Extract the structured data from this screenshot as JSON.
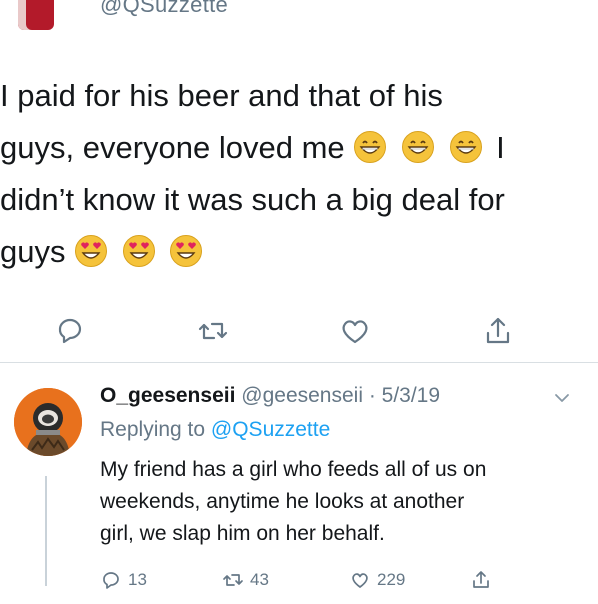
{
  "original_tweet": {
    "handle": "@QSuzzette",
    "text_lines": [
      "I paid for his beer and that of his",
      "guys, everyone loved me",
      "I",
      "didn’t know it was such a big deal for",
      "guys"
    ],
    "emojis": {
      "line2": [
        "grinning-face",
        "grinning-face",
        "grinning-face"
      ],
      "line4": [
        "heart-eyes-face",
        "heart-eyes-face",
        "heart-eyes-face"
      ]
    },
    "actions": [
      "reply-icon",
      "retweet-icon",
      "like-icon",
      "share-icon"
    ]
  },
  "reply": {
    "name": "O_geesenseii",
    "meta": "@geesenseii · 5/3/19",
    "replying_prefix": "Replying to",
    "replying_to": "@QSuzzette",
    "body_lines": [
      "My friend has a girl who feeds all of us on",
      "weekends, anytime he looks at another",
      "girl, we slap him on her behalf."
    ],
    "counts": {
      "replies": "13",
      "retweets": "43",
      "likes": "229"
    }
  },
  "colors": {
    "text": "#14171a",
    "muted": "#657786",
    "link": "#1da1f2",
    "avatar_bg": "#e8711d"
  }
}
